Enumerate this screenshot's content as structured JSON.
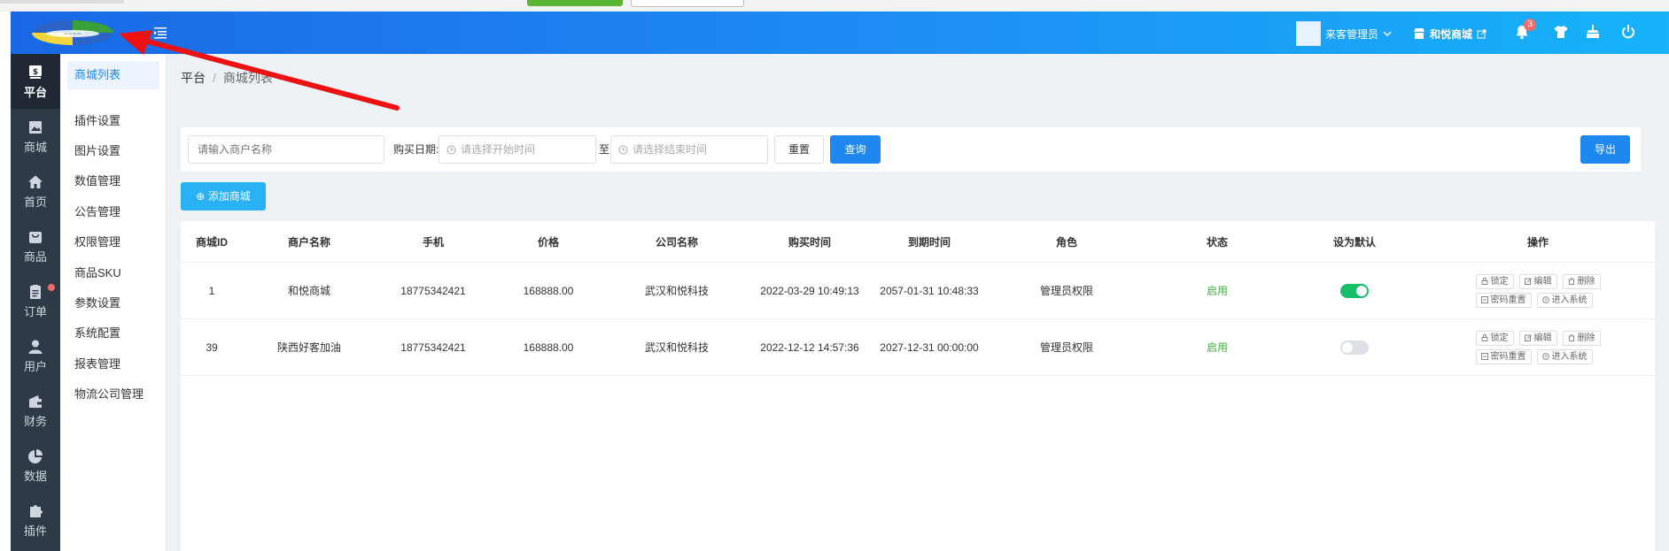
{
  "header": {
    "user_name": "来客管理员",
    "shop_name": "和悦商城",
    "notification_count": "3"
  },
  "rail": {
    "items": [
      {
        "label": "平台",
        "active": true
      },
      {
        "label": "商城"
      },
      {
        "label": "首页"
      },
      {
        "label": "商品"
      },
      {
        "label": "订单"
      },
      {
        "label": "用户"
      },
      {
        "label": "财务"
      },
      {
        "label": "数据"
      },
      {
        "label": "插件"
      }
    ]
  },
  "submenu": {
    "items": [
      {
        "label": "商城列表"
      },
      {
        "label": "插件设置"
      },
      {
        "label": "图片设置"
      },
      {
        "label": "数值管理"
      },
      {
        "label": "公告管理"
      },
      {
        "label": "权限管理"
      },
      {
        "label": "商品SKU"
      },
      {
        "label": "参数设置"
      },
      {
        "label": "系统配置"
      },
      {
        "label": "报表管理"
      },
      {
        "label": "物流公司管理"
      }
    ]
  },
  "breadcrumb": {
    "root": "平台",
    "current": "商城列表"
  },
  "filters": {
    "merchant_placeholder": "请输入商户名称",
    "date_label": "购买日期:",
    "start_placeholder": "请选择开始时间",
    "to_label": "至",
    "end_placeholder": "请选择结束时间",
    "reset_label": "重置",
    "query_label": "查询",
    "export_label": "导出"
  },
  "add_button_label": "添加商城",
  "table": {
    "columns": [
      "商城ID",
      "商户名称",
      "手机",
      "价格",
      "公司名称",
      "购买时间",
      "到期时间",
      "角色",
      "状态",
      "设为默认",
      "操作"
    ],
    "rows": [
      {
        "id": "1",
        "merchant": "和悦商城",
        "phone": "18775342421",
        "price": "168888.00",
        "company": "武汉和悦科技",
        "buy_time": "2022-03-29 10:49:13",
        "expire_time": "2057-01-31 10:48:33",
        "role": "管理员权限",
        "status": "启用",
        "is_default": true
      },
      {
        "id": "39",
        "merchant": "陕西好客加油",
        "phone": "18775342421",
        "price": "168888.00",
        "company": "武汉和悦科技",
        "buy_time": "2022-12-12 14:57:36",
        "expire_time": "2027-12-31 00:00:00",
        "role": "管理员权限",
        "status": "启用",
        "is_default": false
      }
    ],
    "ops": {
      "lock": "锁定",
      "edit": "编辑",
      "delete": "删除",
      "reset_password": "密码重置",
      "enter_system": "进入系统"
    }
  },
  "colors": {
    "primary": "#1e88f0",
    "rail_bg": "#2f3a47",
    "status_enabled": "#3fb23f",
    "switch_on": "#19be6b",
    "annotation": "#ee1111"
  }
}
